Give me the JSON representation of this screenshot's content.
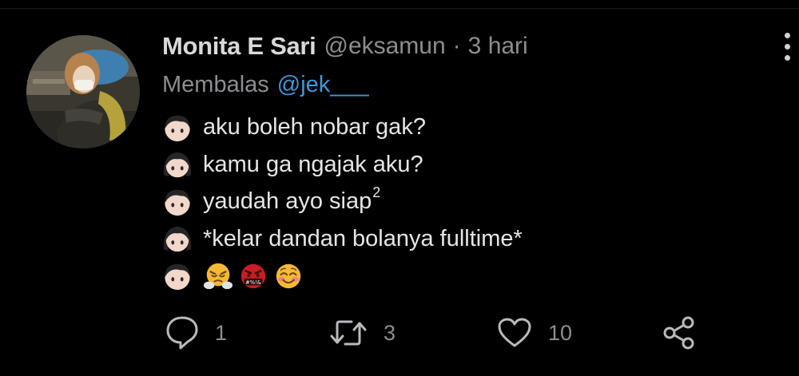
{
  "tweet": {
    "author_name": "Monita E Sari",
    "author_handle": "@eksamun",
    "separator": "·",
    "time": "3 hari",
    "reply_label": "Membalas",
    "reply_to": "@jek___",
    "lines": [
      {
        "icon": "boy-face-emoji",
        "text": "aku boleh nobar gak?"
      },
      {
        "icon": "girl-face-emoji",
        "text": "kamu ga ngajak aku?"
      },
      {
        "icon": "boy-face-emoji",
        "text": "yaudah ayo siap",
        "superscript": "2"
      },
      {
        "icon": "girl-face-emoji",
        "text": "*kelar dandan bolanya fulltime*"
      },
      {
        "icon": "boy-face-emoji",
        "emojis": [
          "face-with-steam-from-nose-emoji",
          "face-with-symbols-on-mouth-emoji",
          "smiling-face-with-blush-emoji"
        ]
      }
    ],
    "more_icon": "more-vertical-icon"
  },
  "actions": {
    "reply": {
      "icon": "reply-icon",
      "count": "1"
    },
    "retweet": {
      "icon": "retweet-icon",
      "count": "3"
    },
    "like": {
      "icon": "heart-icon",
      "count": "10"
    },
    "share": {
      "icon": "share-icon"
    }
  },
  "colors": {
    "background": "#000000",
    "name": "#d9d9d9",
    "muted": "#8b8e92",
    "link": "#3f98d8",
    "text": "#e4e6e7"
  }
}
